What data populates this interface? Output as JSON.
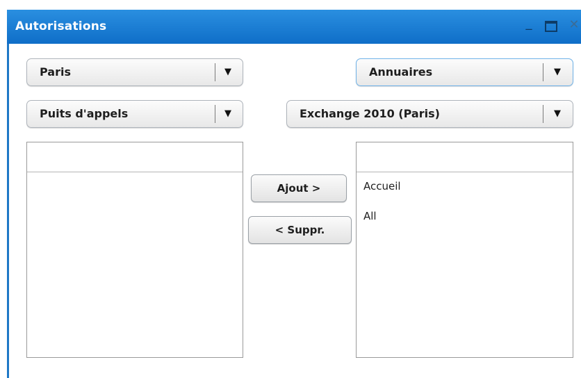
{
  "window": {
    "title": "Autorisations",
    "controls": {
      "minimize": "_",
      "close": "✕"
    }
  },
  "selects": {
    "site": {
      "value": "Paris",
      "arrow": "▼"
    },
    "category": {
      "value": "Annuaires",
      "arrow": "▼"
    },
    "type": {
      "value": "Puits d'appels",
      "arrow": "▼"
    },
    "source": {
      "value": "Exchange 2010 (Paris)",
      "arrow": "▼"
    }
  },
  "left_list": {
    "items": []
  },
  "right_list": {
    "items": [
      "Accueil",
      "All"
    ]
  },
  "buttons": {
    "add": "Ajout >",
    "remove": "< Suppr."
  },
  "colors": {
    "titlebar": "#1675cf",
    "focus_border": "#6fb2e8"
  }
}
